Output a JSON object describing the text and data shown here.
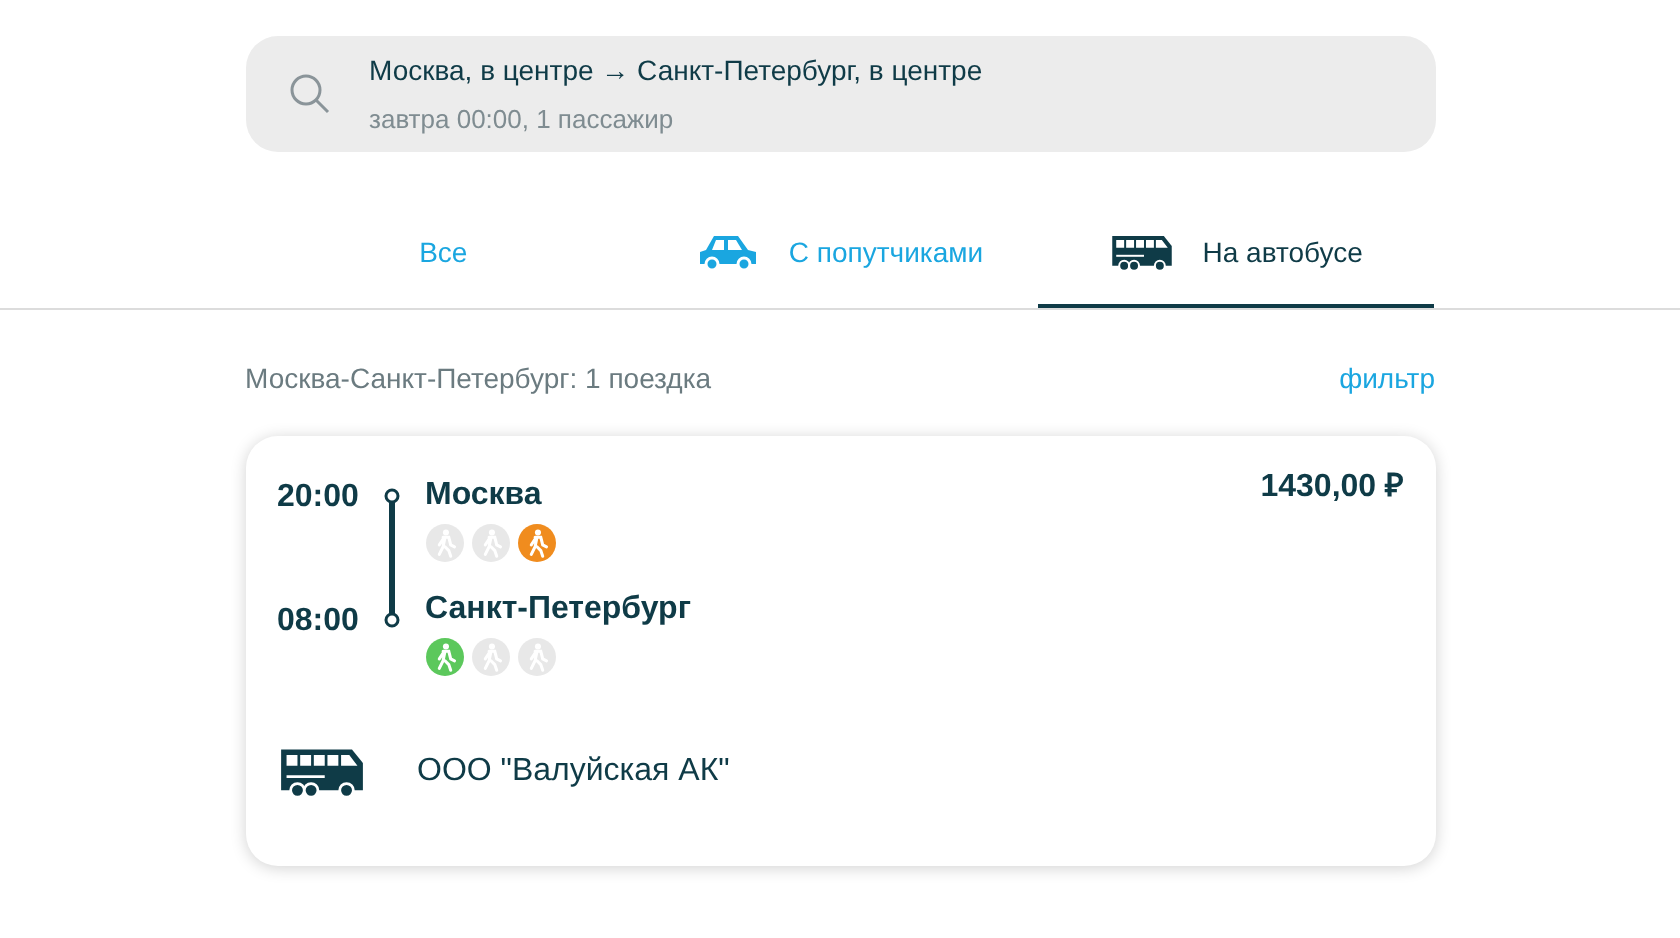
{
  "search": {
    "route": "Москва, в центре → Санкт-Петербург, в центре",
    "details": "завтра 00:00, 1 пассажир"
  },
  "tabs": [
    {
      "label": "Все",
      "kind": "all",
      "selected": false
    },
    {
      "label": "С попутчиками",
      "kind": "car",
      "selected": false
    },
    {
      "label": "На автобусе",
      "kind": "bus",
      "selected": true
    }
  ],
  "summary": "Москва-Санкт-Петербург: 1 поездка",
  "filter_link": "фильтр",
  "trip": {
    "price": "1430,00 ₽",
    "stops": [
      {
        "time": "20:00",
        "city": "Москва",
        "markers": [
          {
            "color": "#e8e8e8"
          },
          {
            "color": "#e8e8e8"
          },
          {
            "color": "#f08c1e"
          }
        ]
      },
      {
        "time": "08:00",
        "city": "Санкт-Петербург",
        "markers": [
          {
            "color": "#5cc85c"
          },
          {
            "color": "#e8e8e8"
          },
          {
            "color": "#e8e8e8"
          }
        ]
      }
    ],
    "carrier": "ООО \"Валуйская АК\""
  }
}
